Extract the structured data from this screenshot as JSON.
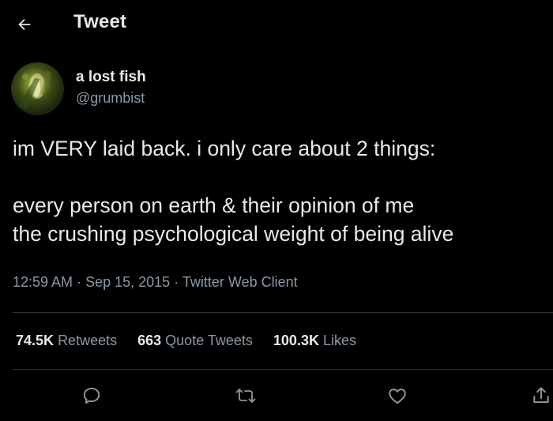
{
  "header": {
    "title": "Tweet",
    "back_icon": "arrow-left-icon"
  },
  "author": {
    "name": "a lost fish",
    "handle": "@grumbist"
  },
  "tweet": {
    "lines": [
      "im VERY laid back. i only care about 2 things:",
      "every person on earth & their opinion of me",
      "the crushing psychological weight of being alive"
    ],
    "time": "12:59 AM",
    "separator": "·",
    "date": "Sep 15, 2015",
    "client": "Twitter Web Client"
  },
  "stats": {
    "retweets_count": "74.5K",
    "retweets_label": "Retweets",
    "quotes_count": "663",
    "quotes_label": "Quote Tweets",
    "likes_count": "100.3K",
    "likes_label": "Likes"
  },
  "actions": [
    "reply-icon",
    "retweet-icon",
    "like-icon",
    "share-icon"
  ],
  "colors": {
    "background": "#000000",
    "primary_text": "#e7e9ea",
    "secondary_text": "#8b98a5",
    "divider": "#2f3336"
  }
}
